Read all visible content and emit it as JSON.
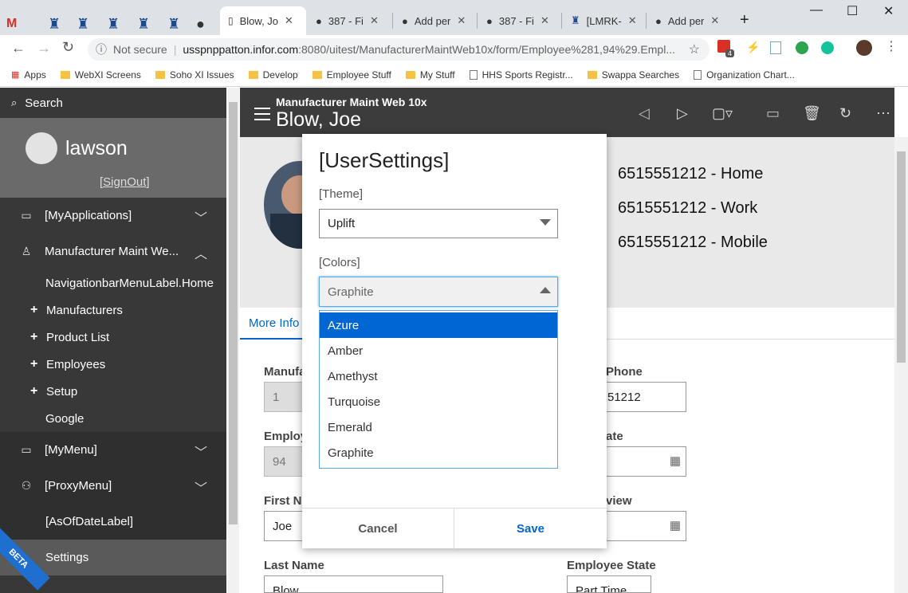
{
  "browser": {
    "tabs": [
      {
        "label": "",
        "icon": "gmail-icon"
      },
      {
        "label": "",
        "icon": "infor-icon"
      },
      {
        "label": "",
        "icon": "infor-icon"
      },
      {
        "label": "",
        "icon": "infor-icon"
      },
      {
        "label": "",
        "icon": "infor-icon"
      },
      {
        "label": "",
        "icon": "infor-icon"
      },
      {
        "label": "",
        "icon": "github-icon"
      },
      {
        "label": "Blow, Jo",
        "icon": "page-icon"
      },
      {
        "label": "387 - Fi",
        "icon": "github-icon"
      },
      {
        "label": "Add per",
        "icon": "github-icon"
      },
      {
        "label": "387 - Fi",
        "icon": "github-icon"
      },
      {
        "label": "[LMRK-",
        "icon": "infor-icon"
      },
      {
        "label": "Add per",
        "icon": "github-icon"
      }
    ],
    "security": "Not secure",
    "url_host": "usspnppatton.infor.com",
    "url_rest": ":8080/uitest/ManufacturerMaintWeb10x/form/Employee%281,94%29.Empl...",
    "bookmarks": [
      "Apps",
      "WebXI Screens",
      "Soho XI Issues",
      "Develop",
      "Employee Stuff",
      "My Stuff",
      "HHS Sports Registr...",
      "Swappa Searches",
      "Organization Chart..."
    ],
    "badge": "4"
  },
  "sidebar": {
    "search": "Search",
    "username": "lawson",
    "signout": "[SignOut]",
    "items": [
      {
        "label": "[MyApplications]"
      },
      {
        "label": "Manufacturer Maint We..."
      }
    ],
    "subitems": [
      {
        "label": "NavigationbarMenuLabel.Home"
      },
      {
        "label": "Manufacturers"
      },
      {
        "label": "Product List"
      },
      {
        "label": "Employees"
      },
      {
        "label": "Setup"
      },
      {
        "label": "Google"
      }
    ],
    "lower": [
      {
        "label": "[MyMenu]"
      },
      {
        "label": "[ProxyMenu]"
      },
      {
        "label": "[AsOfDateLabel]"
      },
      {
        "label": "Settings"
      }
    ],
    "beta": "BETA"
  },
  "main": {
    "app_title": "Manufacturer Maint Web 10x",
    "record_title": "Blow, Joe",
    "phones": [
      "6515551212 - Home",
      "6515551212 - Work",
      "6515551212 - Mobile"
    ],
    "tab": "More Info",
    "fields": {
      "manufacturer_label": "Manufa",
      "manufacturer_value": "1",
      "employee_label": "Employ",
      "employee_value": "94",
      "first_name_label": "First Na",
      "first_name_value": "Joe",
      "last_name_label": "Last Name",
      "last_name_value": "Blow",
      "phone_label": "Phone",
      "phone_value": "51212",
      "date_label": "ate",
      "review_label": "view",
      "employee_state_label": "Employee State",
      "employee_state_value": "Part Time"
    }
  },
  "dialog": {
    "title": "[UserSettings]",
    "theme_label": "[Theme]",
    "theme_value": "Uplift",
    "colors_label": "[Colors]",
    "colors_value": "Graphite",
    "color_options": [
      "Azure",
      "Amber",
      "Amethyst",
      "Turquoise",
      "Emerald",
      "Graphite"
    ],
    "highlighted_option": "Azure",
    "cancel": "Cancel",
    "save": "Save"
  },
  "colors": {
    "accent": "#0066cc",
    "sidebar": "#383838",
    "header": "#3c3c3c",
    "selected_option": "#0066d4"
  }
}
